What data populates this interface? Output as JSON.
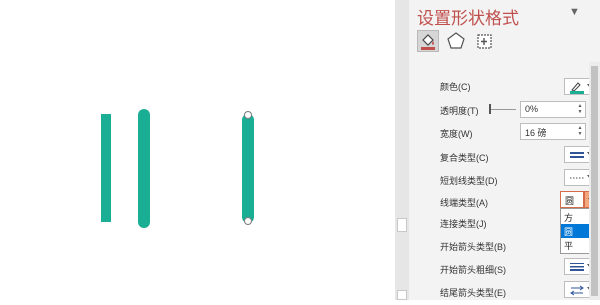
{
  "colors": {
    "accent": "#c0504d",
    "line": "#1aaf95",
    "selected": "#0078d7"
  },
  "pane": {
    "title": "设置形状格式",
    "menu_icon": "caret-down-icon",
    "tabs": [
      {
        "icon": "paint-bucket-icon",
        "active": true
      },
      {
        "icon": "pentagon-icon",
        "active": false
      },
      {
        "icon": "size-properties-icon",
        "active": false
      }
    ],
    "rows": {
      "color": {
        "label": "颜色(C)"
      },
      "transparency": {
        "label": "透明度(T)",
        "value": "0%"
      },
      "width": {
        "label": "宽度(W)",
        "value": "16 磅"
      },
      "compound": {
        "label": "复合类型(C)"
      },
      "dash": {
        "label": "短划线类型(D)"
      },
      "cap": {
        "label": "线端类型(A)",
        "value": "圆",
        "options": [
          "方",
          "圆",
          "平"
        ],
        "selected": "圆"
      },
      "join": {
        "label": "连接类型(J)"
      },
      "begin_arrow": {
        "label": "开始箭头类型(B)"
      },
      "begin_arrow_size": {
        "label": "开始箭头粗细(S)"
      },
      "end_arrow": {
        "label": "结尾箭头类型(E)"
      }
    }
  }
}
